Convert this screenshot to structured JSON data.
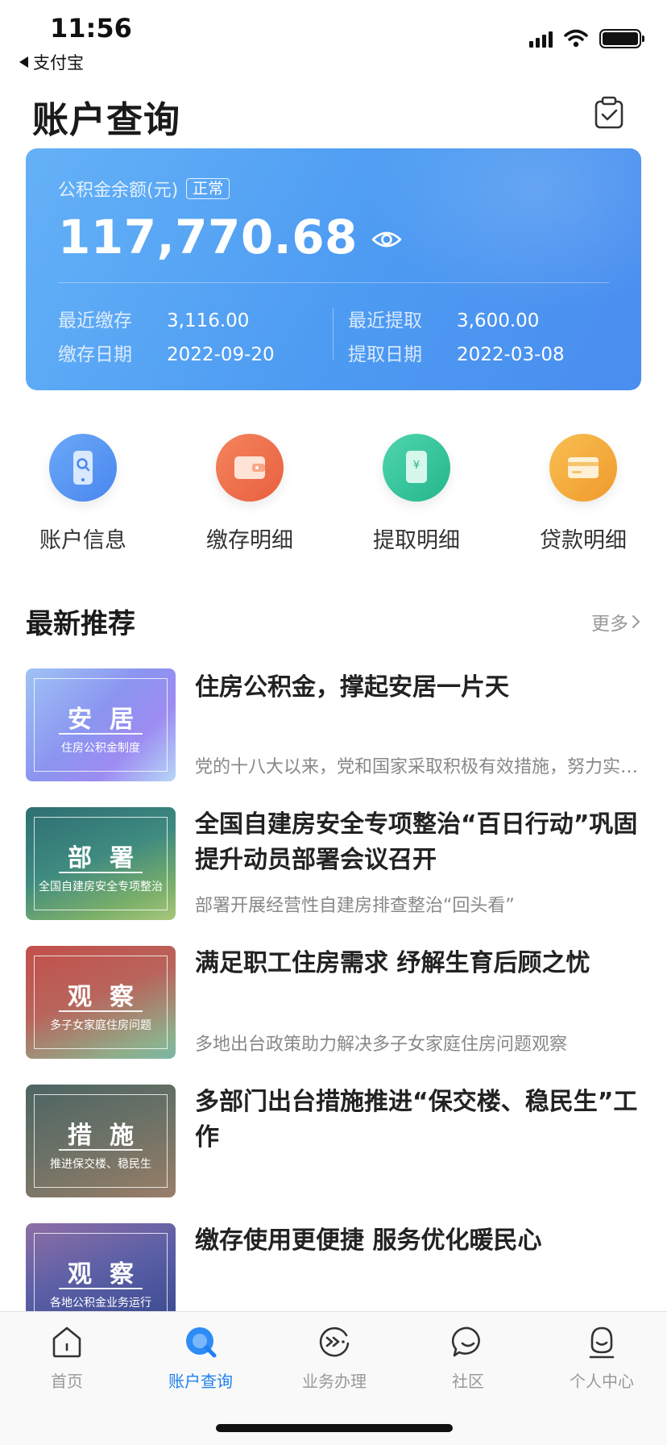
{
  "status_bar": {
    "time": "11:56",
    "back_app": "支付宝"
  },
  "header": {
    "title": "账户查询",
    "action_icon": "clipboard-check-icon"
  },
  "balance_card": {
    "label": "公积金余额(元)",
    "status": "正常",
    "amount": "117,770.68",
    "recent_deposit_label": "最近缴存",
    "recent_deposit_value": "3,116.00",
    "deposit_date_label": "缴存日期",
    "deposit_date_value": "2022-09-20",
    "recent_withdraw_label": "最近提取",
    "recent_withdraw_value": "3,600.00",
    "withdraw_date_label": "提取日期",
    "withdraw_date_value": "2022-03-08",
    "gradient_start": "#64b1f7",
    "gradient_end": "#4a8def"
  },
  "quick_actions": [
    {
      "label": "账户信息",
      "icon": "phone-search-icon",
      "color": "#4e8ff0"
    },
    {
      "label": "缴存明细",
      "icon": "wallet-icon",
      "color": "#f07048"
    },
    {
      "label": "提取明细",
      "icon": "yuan-note-icon",
      "color": "#2fc59c"
    },
    {
      "label": "贷款明细",
      "icon": "card-icon",
      "color": "#f5a53c"
    }
  ],
  "recommend": {
    "title": "最新推荐",
    "more": "更多",
    "items": [
      {
        "thumb_title": "安居",
        "thumb_sub": "住房公积金制度",
        "title": "住房公积金，撑起安居一片天",
        "desc": "党的十八大以来，党和国家采取积极有效措施，努力实现全体人民住有所居"
      },
      {
        "thumb_title": "部署",
        "thumb_sub": "全国自建房安全专项整治",
        "title": "全国自建房安全专项整治“百日行动”巩固提升动员部署会议召开",
        "desc": "部署开展经营性自建房排查整治“回头看”"
      },
      {
        "thumb_title": "观察",
        "thumb_sub": "多子女家庭住房问题",
        "title": "满足职工住房需求 纾解生育后顾之忧",
        "desc": "多地出台政策助力解决多子女家庭住房问题观察"
      },
      {
        "thumb_title": "措施",
        "thumb_sub": "推进保交楼、稳民生",
        "title": "多部门出台措施推进“保交楼、稳民生”工作",
        "desc": ""
      },
      {
        "thumb_title": "观察",
        "thumb_sub": "各地公积金业务运行",
        "title": "缴存使用更便捷 服务优化暖民心",
        "desc": ""
      }
    ]
  },
  "tab_bar": {
    "active_color": "#1e7ff0",
    "tabs": [
      {
        "label": "首页",
        "icon": "home-icon"
      },
      {
        "label": "账户查询",
        "icon": "search-bubble-icon"
      },
      {
        "label": "业务办理",
        "icon": "service-arrows-icon"
      },
      {
        "label": "社区",
        "icon": "chat-bubble-icon"
      },
      {
        "label": "个人中心",
        "icon": "person-icon"
      }
    ]
  }
}
